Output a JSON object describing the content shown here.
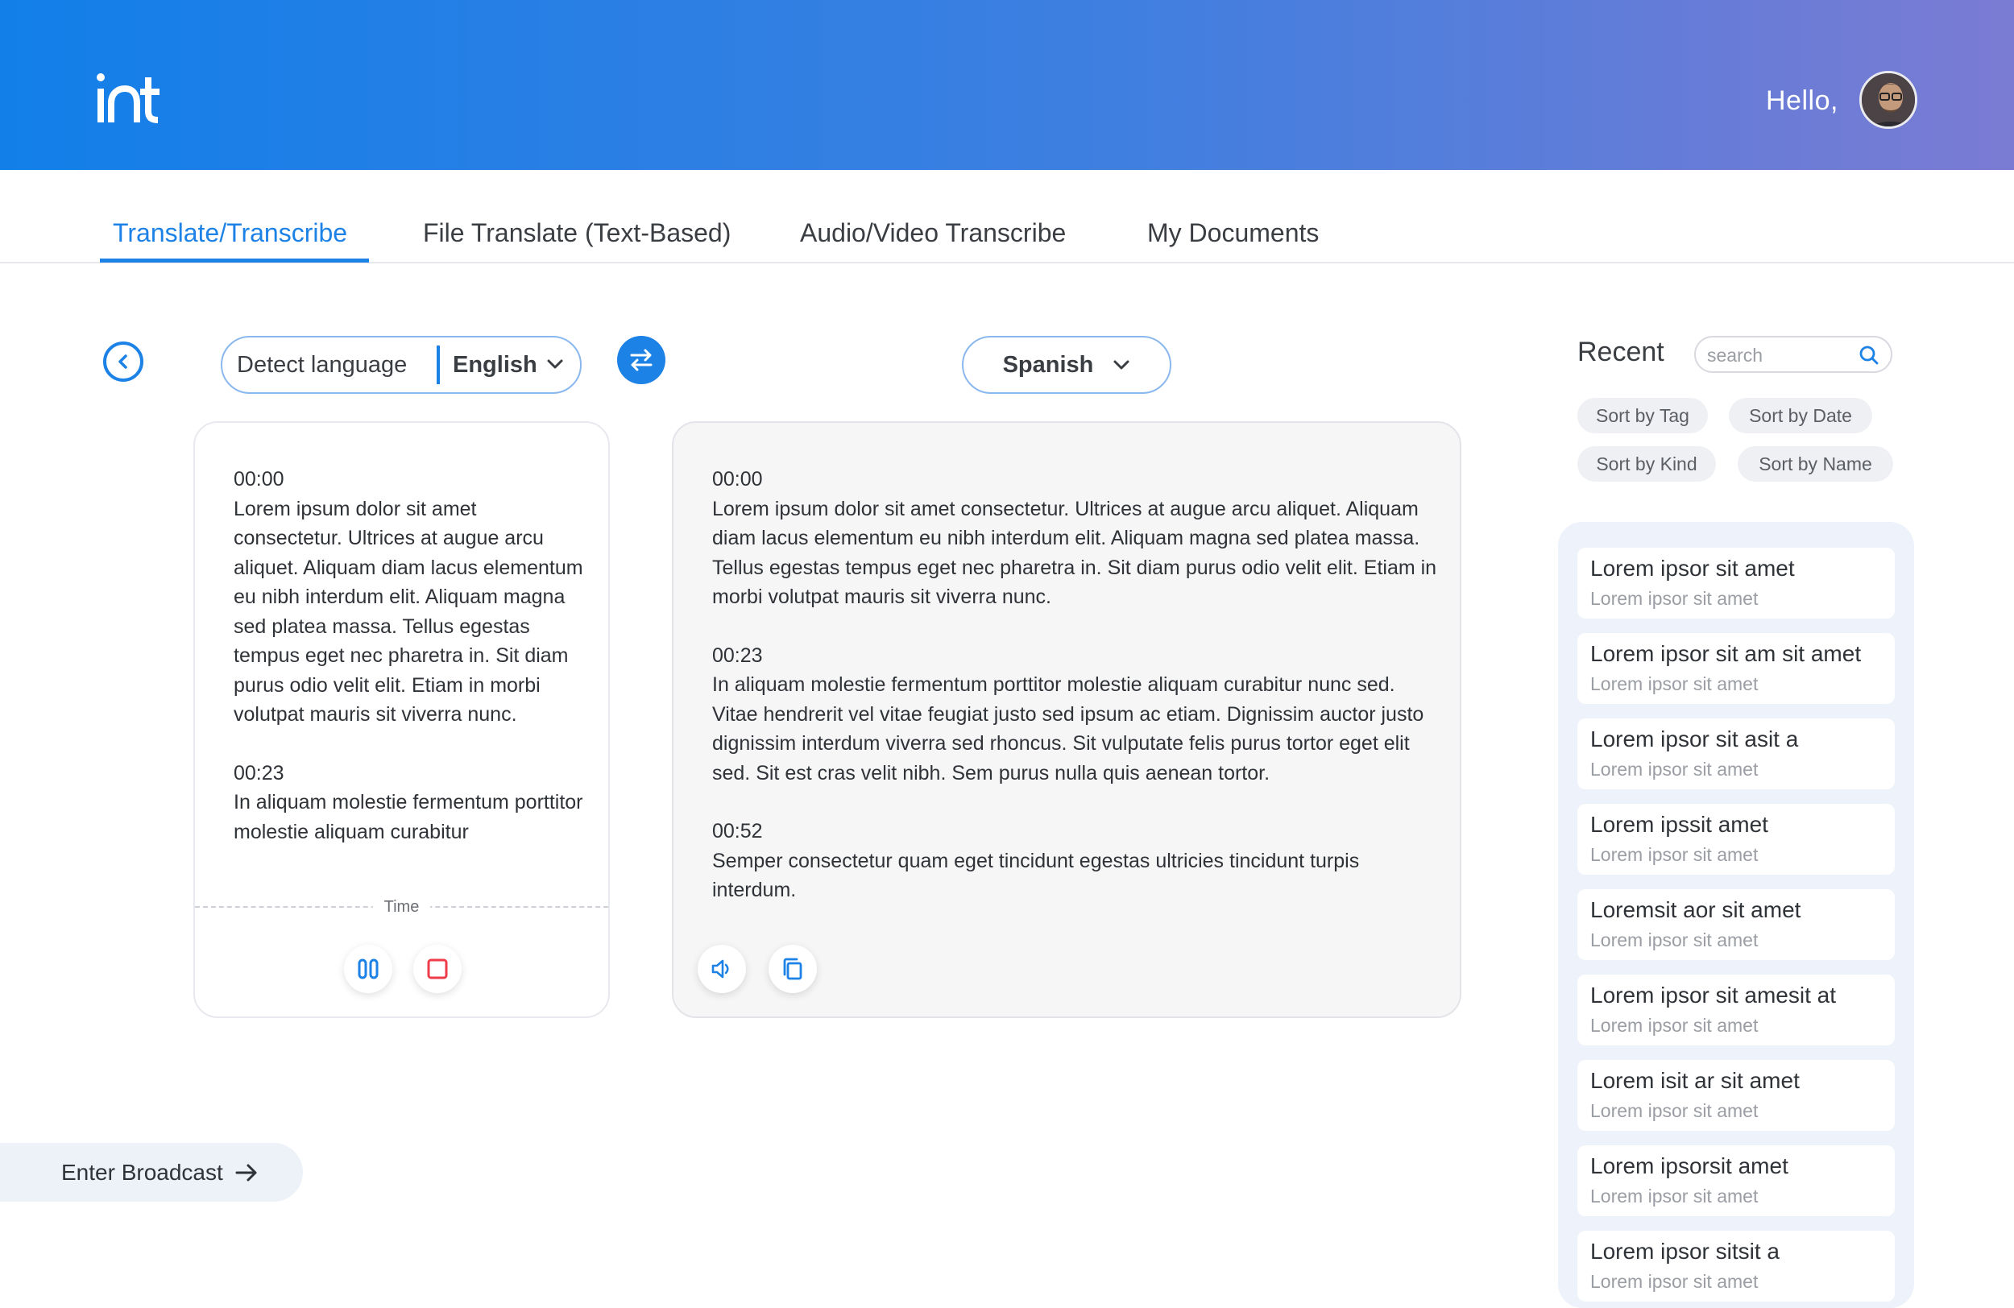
{
  "header": {
    "logo_text": "int",
    "greeting": "Hello,"
  },
  "tabs": [
    {
      "label": "Translate/Transcribe",
      "active": true
    },
    {
      "label": "File Translate (Text-Based)",
      "active": false
    },
    {
      "label": "Audio/Video Transcribe",
      "active": false
    },
    {
      "label": "My Documents",
      "active": false
    }
  ],
  "source": {
    "detect_label": "Detect language",
    "language": "English",
    "segments": [
      {
        "time": "00:00",
        "text": "Lorem ipsum dolor sit amet consectetur. Ultrices at augue arcu aliquet. Aliquam diam lacus elementum eu nibh interdum elit. Aliquam magna sed platea massa. Tellus egestas tempus eget nec pharetra in. Sit diam purus odio velit elit. Etiam in morbi volutpat mauris sit viverra nunc."
      },
      {
        "time": "00:23",
        "text": "In aliquam molestie fermentum porttitor molestie aliquam curabitur"
      }
    ],
    "time_label": "Time"
  },
  "target": {
    "language": "Spanish",
    "segments": [
      {
        "time": "00:00",
        "text": "Lorem ipsum dolor sit amet consectetur. Ultrices at augue arcu aliquet. Aliquam diam lacus elementum eu nibh interdum elit. Aliquam magna sed platea massa. Tellus egestas tempus eget nec pharetra in. Sit diam purus odio velit elit. Etiam in morbi volutpat mauris sit viverra nunc."
      },
      {
        "time": "00:23",
        "text": "In aliquam molestie fermentum porttitor molestie aliquam curabitur nunc sed. Vitae hendrerit vel vitae feugiat justo sed ipsum ac etiam. Dignissim auctor justo dignissim interdum viverra sed rhoncus. Sit vulputate felis purus tortor eget elit sed. Sit est cras velit nibh. Sem purus nulla quis aenean tortor."
      },
      {
        "time": "00:52",
        "text": "Semper consectetur quam eget tincidunt egestas ultricies tincidunt turpis interdum."
      }
    ]
  },
  "recent": {
    "title": "Recent",
    "search_placeholder": "search",
    "sort_options": [
      "Sort by Tag",
      "Sort by Date",
      "Sort by Kind",
      "Sort by Name"
    ],
    "items": [
      {
        "title": "Lorem ipsor sit amet",
        "subtitle": "Lorem ipsor sit amet"
      },
      {
        "title": "Lorem ipsor sit am sit amet",
        "subtitle": "Lorem ipsor sit amet"
      },
      {
        "title": "Lorem ipsor sit asit a",
        "subtitle": "Lorem ipsor sit amet"
      },
      {
        "title": "Lorem ipssit amet",
        "subtitle": "Lorem ipsor sit amet"
      },
      {
        "title": "Loremsit aor sit amet",
        "subtitle": "Lorem ipsor sit amet"
      },
      {
        "title": "Lorem ipsor sit amesit at",
        "subtitle": "Lorem ipsor sit amet"
      },
      {
        "title": "Lorem isit ar sit amet",
        "subtitle": "Lorem ipsor sit amet"
      },
      {
        "title": "Lorem ipsorsit amet",
        "subtitle": "Lorem ipsor sit amet"
      },
      {
        "title": "Lorem ipsor sitsit a",
        "subtitle": "Lorem ipsor sit amet"
      }
    ]
  },
  "broadcast_label": "Enter Broadcast",
  "colors": {
    "accent": "#1d82e6",
    "header_start": "#127fe9",
    "header_end": "#7b7bd3",
    "stop_red": "#ef3b4a"
  },
  "icons": [
    "back-chevron-icon",
    "chevron-down-icon",
    "swap-icon",
    "pause-icon",
    "stop-icon",
    "speaker-icon",
    "copy-icon",
    "search-icon",
    "arrow-right-icon"
  ]
}
